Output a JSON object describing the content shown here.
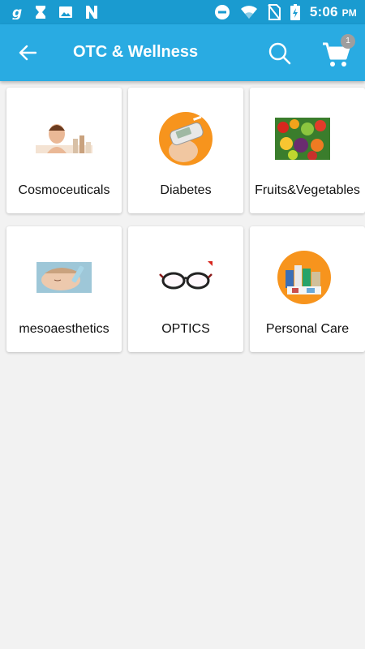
{
  "status_bar": {
    "time": "5:06",
    "ampm": "PM",
    "colors": {
      "background": "#1a9bd0"
    }
  },
  "app_bar": {
    "title": "OTC & Wellness",
    "cart_count": "1",
    "colors": {
      "background": "#29abe2",
      "badge": "#9e9e9e"
    }
  },
  "categories": [
    {
      "label": "Cosmoceuticals",
      "icon": "cosmetics-image"
    },
    {
      "label": "Diabetes",
      "icon": "glucose-meter-image"
    },
    {
      "label": "Fruits&Vegetables",
      "icon": "fruits-vegetables-image"
    },
    {
      "label": "mesoaesthetics",
      "icon": "face-treatment-image"
    },
    {
      "label": "OPTICS",
      "icon": "eyeglasses-image"
    },
    {
      "label": "Personal Care",
      "icon": "personal-care-products-image"
    }
  ]
}
